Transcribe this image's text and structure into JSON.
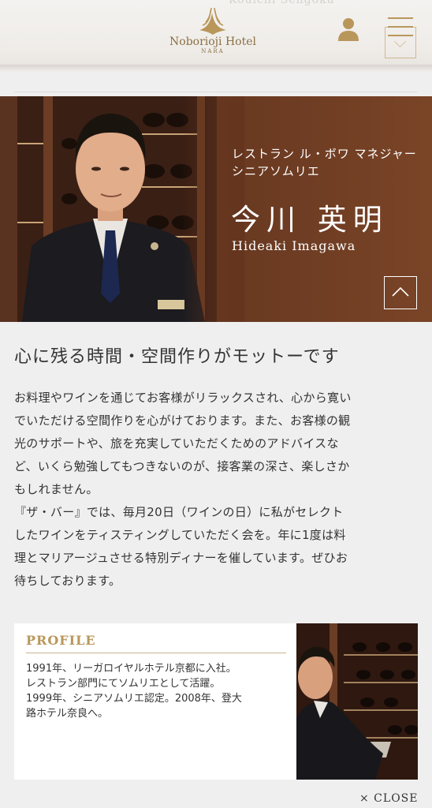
{
  "header": {
    "logo_name": "Noborioji Hotel",
    "logo_sub": "NARA",
    "faded_name": "Kouichi Sengoku"
  },
  "hero": {
    "title_line1": "レストラン ル・ボワ マネジャー",
    "title_line2": "シニアソムリエ",
    "name_jp": "今川 英明",
    "name_en": "Hideaki Imagawa"
  },
  "headline": "心に残る時間・空間作りがモットーです",
  "body": {
    "lines": [
      "お料理やワインを通じてお客様がリラックスされ、心から寛い",
      "でいただける空間作りを心がけております。また、お客様の観",
      "光のサポートや、旅を充実していただくためのアドバイスな",
      "ど、いくら勉強してもつきないのが、接客業の深さ、楽しさか",
      "もしれません。",
      "『ザ・バー』では、毎月20日（ワインの日）に私がセレクト",
      "したワインをティスティングしていただく会を。年に1度は料",
      "理とマリアージュさせる特別ディナーを催しています。ぜひお",
      "待ちしております。"
    ]
  },
  "profile": {
    "label": "PROFILE",
    "lines": [
      "1991年、リーガロイヤルホテル京都に入社。",
      "レストラン部門にてソムリエとして活躍。",
      "1999年、シニアソムリエ認定。2008年、登大",
      "路ホテル奈良へ。"
    ]
  },
  "close_label": "× CLOSE",
  "colors": {
    "accent": "#b9975b",
    "hero_bg": "#6b3a22"
  }
}
